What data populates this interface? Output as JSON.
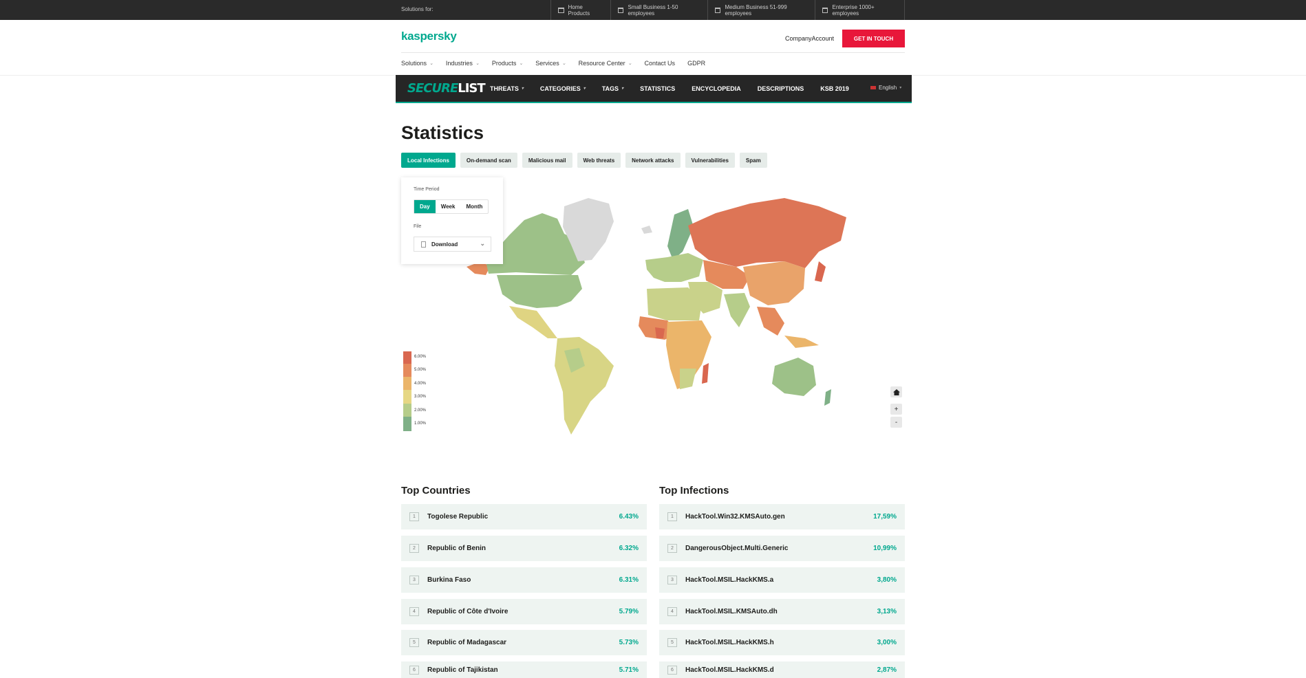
{
  "topbar": {
    "label": "Solutions for:",
    "items": [
      {
        "label": "Home Products",
        "icon": "house-icon"
      },
      {
        "label": "Small Business 1-50 employees",
        "icon": "store-icon"
      },
      {
        "label": "Medium Business 51-999 employees",
        "icon": "building-icon"
      },
      {
        "label": "Enterprise 1000+ employees",
        "icon": "enterprise-icon"
      }
    ]
  },
  "header": {
    "logo": "kaspersky",
    "account": "CompanyAccount",
    "cta": "GET IN TOUCH",
    "nav": [
      "Solutions",
      "Industries",
      "Products",
      "Services",
      "Resource Center",
      "Contact Us",
      "GDPR"
    ]
  },
  "securelist": {
    "logo_a": "SECURE",
    "logo_b": "LIST",
    "nav": [
      "THREATS",
      "CATEGORIES",
      "TAGS",
      "STATISTICS",
      "ENCYCLOPEDIA",
      "DESCRIPTIONS",
      "KSB 2019"
    ],
    "language": "English"
  },
  "stats": {
    "title": "Statistics",
    "tabs": [
      "Local Infections",
      "On-demand scan",
      "Malicious mail",
      "Web threats",
      "Network attacks",
      "Vulnerabilities",
      "Spam"
    ],
    "active_tab": "Local Infections",
    "panel": {
      "time_period_label": "Time Period",
      "periods": [
        "Day",
        "Week",
        "Month"
      ],
      "active_period": "Day",
      "file_label": "File",
      "download": "Download"
    },
    "legend": [
      "6.00%",
      "5.00%",
      "4.00%",
      "3.00%",
      "2.00%",
      "1.00%"
    ],
    "legend_colors": [
      "#d9674f",
      "#e58a5c",
      "#ebb56a",
      "#e6d784",
      "#b6cd8a",
      "#7fb087"
    ],
    "map_controls": {
      "home": "home-icon",
      "zoom_in": "+",
      "zoom_out": "-"
    }
  },
  "top_countries": {
    "title": "Top Countries",
    "rows": [
      {
        "rank": "1",
        "name": "Togolese Republic",
        "value": "6.43%"
      },
      {
        "rank": "2",
        "name": "Republic of Benin",
        "value": "6.32%"
      },
      {
        "rank": "3",
        "name": "Burkina Faso",
        "value": "6.31%"
      },
      {
        "rank": "4",
        "name": "Republic of Côte d'Ivoire",
        "value": "5.79%"
      },
      {
        "rank": "5",
        "name": "Republic of Madagascar",
        "value": "5.73%"
      },
      {
        "rank": "6",
        "name": "Republic of Tajikistan",
        "value": "5.71%"
      }
    ]
  },
  "top_infections": {
    "title": "Top Infections",
    "rows": [
      {
        "rank": "1",
        "name": "HackTool.Win32.KMSAuto.gen",
        "value": "17,59%"
      },
      {
        "rank": "2",
        "name": "DangerousObject.Multi.Generic",
        "value": "10,99%"
      },
      {
        "rank": "3",
        "name": "HackTool.MSIL.HackKMS.a",
        "value": "3,80%"
      },
      {
        "rank": "4",
        "name": "HackTool.MSIL.KMSAuto.dh",
        "value": "3,13%"
      },
      {
        "rank": "5",
        "name": "HackTool.MSIL.HackKMS.h",
        "value": "3,00%"
      },
      {
        "rank": "6",
        "name": "HackTool.MSIL.HackKMS.d",
        "value": "2,87%"
      }
    ]
  }
}
